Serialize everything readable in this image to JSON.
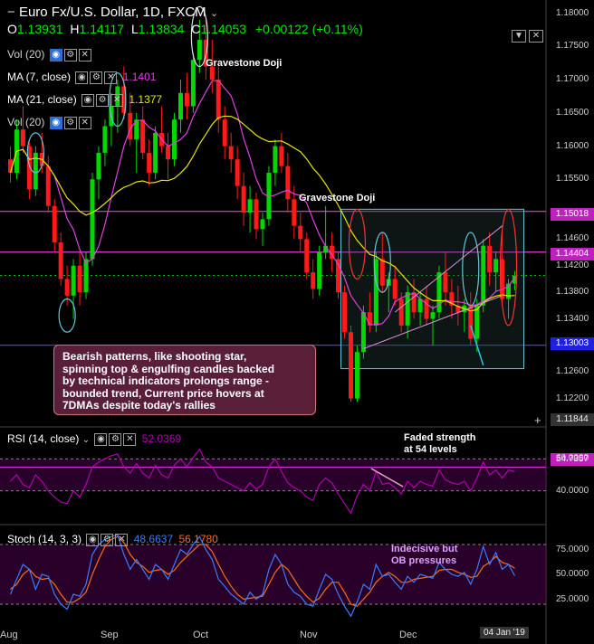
{
  "header": {
    "symbol": "Euro Fx/U.S. Dollar, 1D, FXCM",
    "open_label": "O",
    "open": "1.13931",
    "high_label": "H",
    "high": "1.14117",
    "low_label": "L",
    "low": "1.13834",
    "close_label": "C",
    "close": "1.14053",
    "change": "+0.00122 (+0.11%)"
  },
  "indicators": {
    "vol1": "Vol (20)",
    "ma7": "MA (7, close)",
    "ma7_value": "1.1401",
    "ma21": "MA (21, close)",
    "ma21_value": "1.1377",
    "vol2": "Vol (20)",
    "rsi": "RSI (14, close)",
    "rsi_value": "52.0369",
    "stoch": "Stoch (14, 3, 3)",
    "stoch_k": "48.6637",
    "stoch_d": "56.1780"
  },
  "annotations": {
    "doji1": "Gravestone Doji",
    "doji2": "Gravestone Doji",
    "note": "Bearish patterns, like shooting star,\nspinning top & engulfing candles backed\nby technical indicators prolongs range -\nbounded trend, Current price hovers at\n7DMAs despite today's rallies",
    "rsi_note": "Faded strength\nat 54 levels",
    "stoch_note": "Indecisive but\nOB pressures"
  },
  "price_tags": {
    "level_upper": "1.15018",
    "level_mid": "1.14404",
    "level_lower": "1.13003",
    "last": "1.11844",
    "rsi_last": "54.7357"
  },
  "axis": {
    "price_ticks": [
      "1.18000",
      "1.17500",
      "1.17000",
      "1.16500",
      "1.16000",
      "1.15500",
      "1.14600",
      "1.14200",
      "1.13800",
      "1.13400",
      "1.12600",
      "1.12200"
    ],
    "rsi_ticks": [
      "60.0000",
      "40.0000"
    ],
    "stoch_ticks": [
      "75.0000",
      "50.0000",
      "25.0000"
    ],
    "months": [
      "Aug",
      "Sep",
      "Oct",
      "Nov",
      "Dec"
    ],
    "date_tag": "04 Jan '19"
  },
  "colors": {
    "up": "#00d800",
    "down": "#ff1a1a",
    "ma7": "#e040e0",
    "ma21": "#e6e600",
    "level": "#e040e0",
    "support": "#3b3bff",
    "rsi": "#b000b0",
    "stoch_k": "#3a7bff",
    "stoch_d": "#ff6a1a",
    "range_box": "#66c6d8"
  },
  "chart_data": {
    "type": "candlestick",
    "title": "Euro Fx/U.S. Dollar, 1D, FXCM",
    "ylim": [
      1.118,
      1.182
    ],
    "candles": [
      [
        1.158,
        1.16,
        1.1545,
        1.156
      ],
      [
        1.156,
        1.164,
        1.155,
        1.1625
      ],
      [
        1.1625,
        1.166,
        1.159,
        1.16
      ],
      [
        1.16,
        1.161,
        1.152,
        1.1535
      ],
      [
        1.1535,
        1.16,
        1.1525,
        1.159
      ],
      [
        1.159,
        1.162,
        1.156,
        1.157
      ],
      [
        1.157,
        1.1585,
        1.15,
        1.151
      ],
      [
        1.151,
        1.152,
        1.144,
        1.1455
      ],
      [
        1.1455,
        1.147,
        1.139,
        1.14
      ],
      [
        1.14,
        1.142,
        1.136,
        1.1375
      ],
      [
        1.1375,
        1.143,
        1.134,
        1.142
      ],
      [
        1.142,
        1.144,
        1.136,
        1.138
      ],
      [
        1.138,
        1.144,
        1.137,
        1.143
      ],
      [
        1.143,
        1.156,
        1.142,
        1.155
      ],
      [
        1.155,
        1.16,
        1.152,
        1.159
      ],
      [
        1.159,
        1.164,
        1.157,
        1.163
      ],
      [
        1.163,
        1.168,
        1.16,
        1.166
      ],
      [
        1.166,
        1.17,
        1.162,
        1.169
      ],
      [
        1.169,
        1.172,
        1.164,
        1.165
      ],
      [
        1.165,
        1.168,
        1.16,
        1.161
      ],
      [
        1.161,
        1.165,
        1.156,
        1.164
      ],
      [
        1.164,
        1.166,
        1.158,
        1.159
      ],
      [
        1.159,
        1.161,
        1.154,
        1.156
      ],
      [
        1.156,
        1.163,
        1.155,
        1.162
      ],
      [
        1.162,
        1.166,
        1.159,
        1.16
      ],
      [
        1.16,
        1.162,
        1.155,
        1.158
      ],
      [
        1.158,
        1.165,
        1.157,
        1.164
      ],
      [
        1.164,
        1.17,
        1.162,
        1.168
      ],
      [
        1.168,
        1.171,
        1.164,
        1.166
      ],
      [
        1.166,
        1.174,
        1.165,
        1.173
      ],
      [
        1.173,
        1.179,
        1.171,
        1.176
      ],
      [
        1.176,
        1.179,
        1.17,
        1.172
      ],
      [
        1.172,
        1.176,
        1.168,
        1.17
      ],
      [
        1.17,
        1.172,
        1.162,
        1.164
      ],
      [
        1.164,
        1.166,
        1.158,
        1.16
      ],
      [
        1.16,
        1.162,
        1.156,
        1.158
      ],
      [
        1.158,
        1.16,
        1.152,
        1.154
      ],
      [
        1.154,
        1.156,
        1.148,
        1.15
      ],
      [
        1.15,
        1.154,
        1.147,
        1.152
      ],
      [
        1.152,
        1.153,
        1.146,
        1.1475
      ],
      [
        1.1475,
        1.15,
        1.145,
        1.149
      ],
      [
        1.149,
        1.157,
        1.148,
        1.156
      ],
      [
        1.156,
        1.161,
        1.154,
        1.16
      ],
      [
        1.16,
        1.162,
        1.156,
        1.157
      ],
      [
        1.157,
        1.159,
        1.15,
        1.152
      ],
      [
        1.152,
        1.154,
        1.146,
        1.148
      ],
      [
        1.148,
        1.15,
        1.144,
        1.146
      ],
      [
        1.146,
        1.147,
        1.14,
        1.141
      ],
      [
        1.141,
        1.143,
        1.137,
        1.1385
      ],
      [
        1.1385,
        1.145,
        1.1375,
        1.144
      ],
      [
        1.144,
        1.151,
        1.143,
        1.145
      ],
      [
        1.145,
        1.147,
        1.141,
        1.143
      ],
      [
        1.143,
        1.144,
        1.137,
        1.138
      ],
      [
        1.138,
        1.139,
        1.131,
        1.132
      ],
      [
        1.132,
        1.133,
        1.1215,
        1.122
      ],
      [
        1.122,
        1.13,
        1.1215,
        1.129
      ],
      [
        1.129,
        1.136,
        1.128,
        1.135
      ],
      [
        1.135,
        1.138,
        1.132,
        1.133
      ],
      [
        1.133,
        1.144,
        1.132,
        1.143
      ],
      [
        1.143,
        1.147,
        1.138,
        1.139
      ],
      [
        1.139,
        1.141,
        1.135,
        1.14
      ],
      [
        1.14,
        1.142,
        1.136,
        1.137
      ],
      [
        1.137,
        1.138,
        1.132,
        1.133
      ],
      [
        1.133,
        1.139,
        1.131,
        1.138
      ],
      [
        1.138,
        1.14,
        1.134,
        1.135
      ],
      [
        1.135,
        1.138,
        1.133,
        1.137
      ],
      [
        1.137,
        1.139,
        1.133,
        1.134
      ],
      [
        1.134,
        1.136,
        1.13,
        1.135
      ],
      [
        1.135,
        1.142,
        1.134,
        1.141
      ],
      [
        1.141,
        1.144,
        1.136,
        1.138
      ],
      [
        1.138,
        1.14,
        1.134,
        1.136
      ],
      [
        1.136,
        1.139,
        1.133,
        1.135
      ],
      [
        1.135,
        1.137,
        1.132,
        1.136
      ],
      [
        1.136,
        1.138,
        1.13,
        1.131
      ],
      [
        1.131,
        1.137,
        1.129,
        1.136
      ],
      [
        1.136,
        1.146,
        1.135,
        1.145
      ],
      [
        1.145,
        1.147,
        1.139,
        1.141
      ],
      [
        1.141,
        1.144,
        1.138,
        1.143
      ],
      [
        1.143,
        1.147,
        1.136,
        1.137
      ],
      [
        1.137,
        1.14,
        1.134,
        1.1393
      ],
      [
        1.1393,
        1.1412,
        1.1383,
        1.1405
      ]
    ],
    "levels": {
      "upper_resistance": 1.15018,
      "mid_resistance": 1.14404,
      "support": 1.13003,
      "current": 1.14053
    },
    "rsi": {
      "ylim": [
        20,
        80
      ],
      "overbought_line": 60,
      "oversold_line": 40,
      "values": [
        46,
        50,
        44,
        42,
        50,
        46,
        40,
        36,
        33,
        32,
        40,
        36,
        44,
        55,
        58,
        60,
        62,
        63,
        55,
        51,
        57,
        51,
        48,
        56,
        50,
        48,
        56,
        60,
        55,
        61,
        66,
        58,
        55,
        48,
        46,
        44,
        42,
        40,
        45,
        41,
        44,
        55,
        60,
        52,
        45,
        42,
        40,
        36,
        34,
        44,
        48,
        45,
        38,
        32,
        26,
        37,
        44,
        40,
        52,
        44,
        45,
        42,
        38,
        46,
        42,
        46,
        44,
        43,
        53,
        47,
        45,
        44,
        46,
        40,
        48,
        58,
        50,
        53,
        48,
        53,
        52
      ]
    },
    "stoch": {
      "ylim": [
        0,
        100
      ],
      "k": [
        30,
        45,
        60,
        55,
        35,
        50,
        48,
        30,
        20,
        15,
        30,
        28,
        40,
        70,
        80,
        85,
        88,
        90,
        70,
        55,
        65,
        55,
        45,
        60,
        55,
        45,
        60,
        75,
        70,
        80,
        88,
        75,
        65,
        45,
        38,
        30,
        25,
        20,
        32,
        25,
        30,
        55,
        70,
        60,
        40,
        32,
        28,
        20,
        18,
        35,
        50,
        45,
        30,
        18,
        8,
        22,
        40,
        35,
        60,
        48,
        50,
        42,
        35,
        48,
        42,
        50,
        48,
        46,
        62,
        55,
        50,
        48,
        52,
        40,
        55,
        78,
        60,
        72,
        55,
        60,
        48.66
      ],
      "d": [
        35,
        40,
        50,
        55,
        48,
        45,
        46,
        40,
        30,
        22,
        22,
        26,
        32,
        50,
        65,
        78,
        85,
        88,
        82,
        70,
        62,
        58,
        52,
        54,
        55,
        50,
        54,
        62,
        68,
        74,
        80,
        80,
        73,
        60,
        48,
        38,
        30,
        25,
        26,
        27,
        28,
        40,
        52,
        60,
        55,
        45,
        35,
        28,
        22,
        26,
        35,
        42,
        42,
        32,
        20,
        18,
        25,
        32,
        42,
        48,
        52,
        48,
        42,
        42,
        45,
        46,
        47,
        48,
        54,
        55,
        55,
        52,
        50,
        47,
        48,
        58,
        62,
        68,
        62,
        60,
        56.18
      ]
    }
  }
}
